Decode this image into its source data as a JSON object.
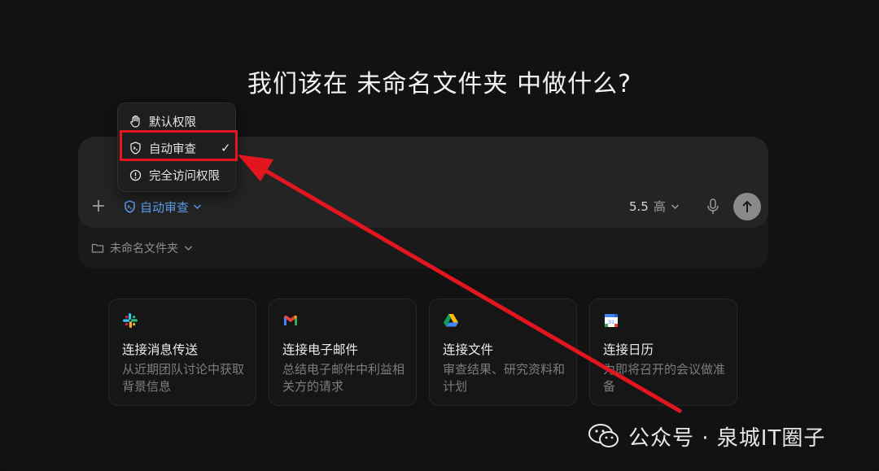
{
  "heading": "我们该在 未命名文件夹 中做什么?",
  "menu": {
    "items": [
      {
        "label": "默认权限",
        "icon": "hand-icon"
      },
      {
        "label": "自动审查",
        "icon": "shield-terminal-icon",
        "checked": true
      },
      {
        "label": "完全访问权限",
        "icon": "alert-circle-icon"
      }
    ],
    "check": "✓"
  },
  "composer": {
    "plus": "+",
    "mode_label": "自动审查",
    "model_version": "5.5",
    "model_effort": "高"
  },
  "folder": {
    "label": "未命名文件夹"
  },
  "cards": [
    {
      "icon": "slack-icon",
      "title": "连接消息传送",
      "desc": "从近期团队讨论中获取背景信息"
    },
    {
      "icon": "gmail-icon",
      "title": "连接电子邮件",
      "desc": "总结电子邮件中利益相关方的请求"
    },
    {
      "icon": "google-drive-icon",
      "title": "连接文件",
      "desc": "审查结果、研究资料和计划"
    },
    {
      "icon": "google-calendar-icon",
      "title": "连接日历",
      "desc": "为即将召开的会议做准备"
    }
  ],
  "watermark": {
    "text": "公众号 · 泉城IT圈子"
  },
  "colors": {
    "accent_blue": "#5aa0f0",
    "highlight_red": "#e3151f",
    "background": "#121212"
  }
}
